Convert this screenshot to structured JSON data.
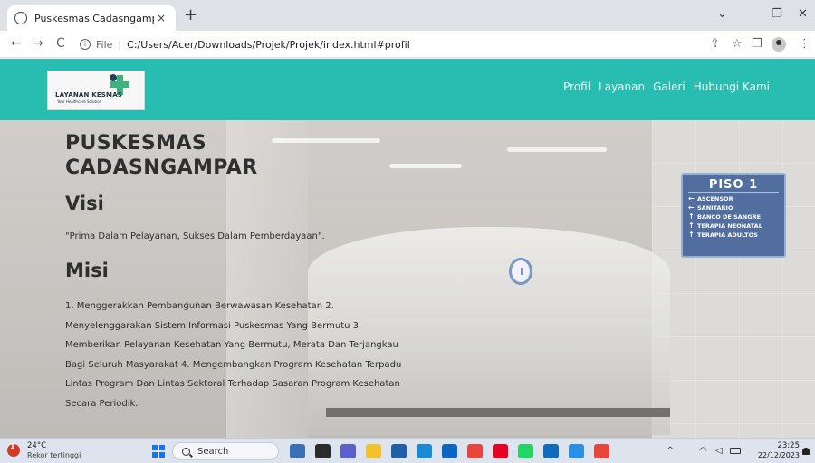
{
  "browser": {
    "tab_title": "Puskesmas Cadasngampar",
    "tab_close": "×",
    "new_tab": "+",
    "url_scheme": "File",
    "url_separator": "|",
    "url_path": "C:/Users/Acer/Downloads/Projek/Projek/index.html#profil",
    "back": "←",
    "forward": "→",
    "reload": "C",
    "info": "i",
    "share": "⇪",
    "bookmark": "☆",
    "sidebar": "❐",
    "more": "⋮",
    "minimize": "–",
    "restore": "❐",
    "close": "✕",
    "tab_search": "⌄"
  },
  "header": {
    "logo_title": "LAYANAN KESMAS",
    "logo_subtitle": "Your Healthcare Solution",
    "nav": [
      "Profil",
      "Layanan",
      "Galeri",
      "Hubungi Kami"
    ]
  },
  "hero": {
    "sign": {
      "title": "PISO 1",
      "rows": [
        {
          "arrow": "←",
          "label": "ASCENSOR"
        },
        {
          "arrow": "←",
          "label": "SANITARIO"
        },
        {
          "arrow": "↑",
          "label": "BANCO DE SANGRE"
        },
        {
          "arrow": "↑",
          "label": "TERAPIA NEONATAL"
        },
        {
          "arrow": "↑",
          "label": "TERAPIA ADULTOS"
        }
      ]
    }
  },
  "content": {
    "site_title": "PUSKESMAS CADASNGAMPAR",
    "visi_heading": "Visi",
    "visi_text": "\"Prima Dalam Pelayanan, Sukses Dalam Pemberdayaan\".",
    "misi_heading": "Misi",
    "misi_text": "1. Menggerakkan Pembangunan Berwawasan Kesehatan 2. Menyelenggarakan Sistem Informasi Puskesmas Yang Bermutu 3. Memberikan Pelayanan Kesehatan Yang Bermutu, Merata Dan Terjangkau Bagi Seluruh Masyarakat 4. Mengembangkan Program Kesehatan Terpadu Lintas Program Dan Lintas Sektoral Terhadap Sasaran Program Kesehatan Secara Periodik."
  },
  "taskbar": {
    "weather_badge": "1",
    "weather_temp": "24°C",
    "weather_desc": "Rekor tertinggi",
    "search_label": "Search",
    "apps": [
      {
        "name": "widgets",
        "color": "#3a6fb4"
      },
      {
        "name": "file-explorer-dark",
        "color": "#2b2b2b"
      },
      {
        "name": "teams",
        "color": "#5b5fc7"
      },
      {
        "name": "file-explorer",
        "color": "#f2c12e"
      },
      {
        "name": "store",
        "color": "#1f5fa8"
      },
      {
        "name": "edge",
        "color": "#1a8ad4"
      },
      {
        "name": "store-2",
        "color": "#0a66c2"
      },
      {
        "name": "chrome",
        "color": "#e8453c"
      },
      {
        "name": "pinterest",
        "color": "#e60023"
      },
      {
        "name": "whatsapp",
        "color": "#25d366"
      },
      {
        "name": "mail",
        "color": "#0f6cbd"
      },
      {
        "name": "vscode",
        "color": "#2b8fe3"
      },
      {
        "name": "chrome-2",
        "color": "#e8453c"
      }
    ],
    "tray_chevron": "^",
    "tray_wifi": "◠",
    "tray_volume": "◁",
    "time": "23:25",
    "date": "22/12/2023"
  }
}
